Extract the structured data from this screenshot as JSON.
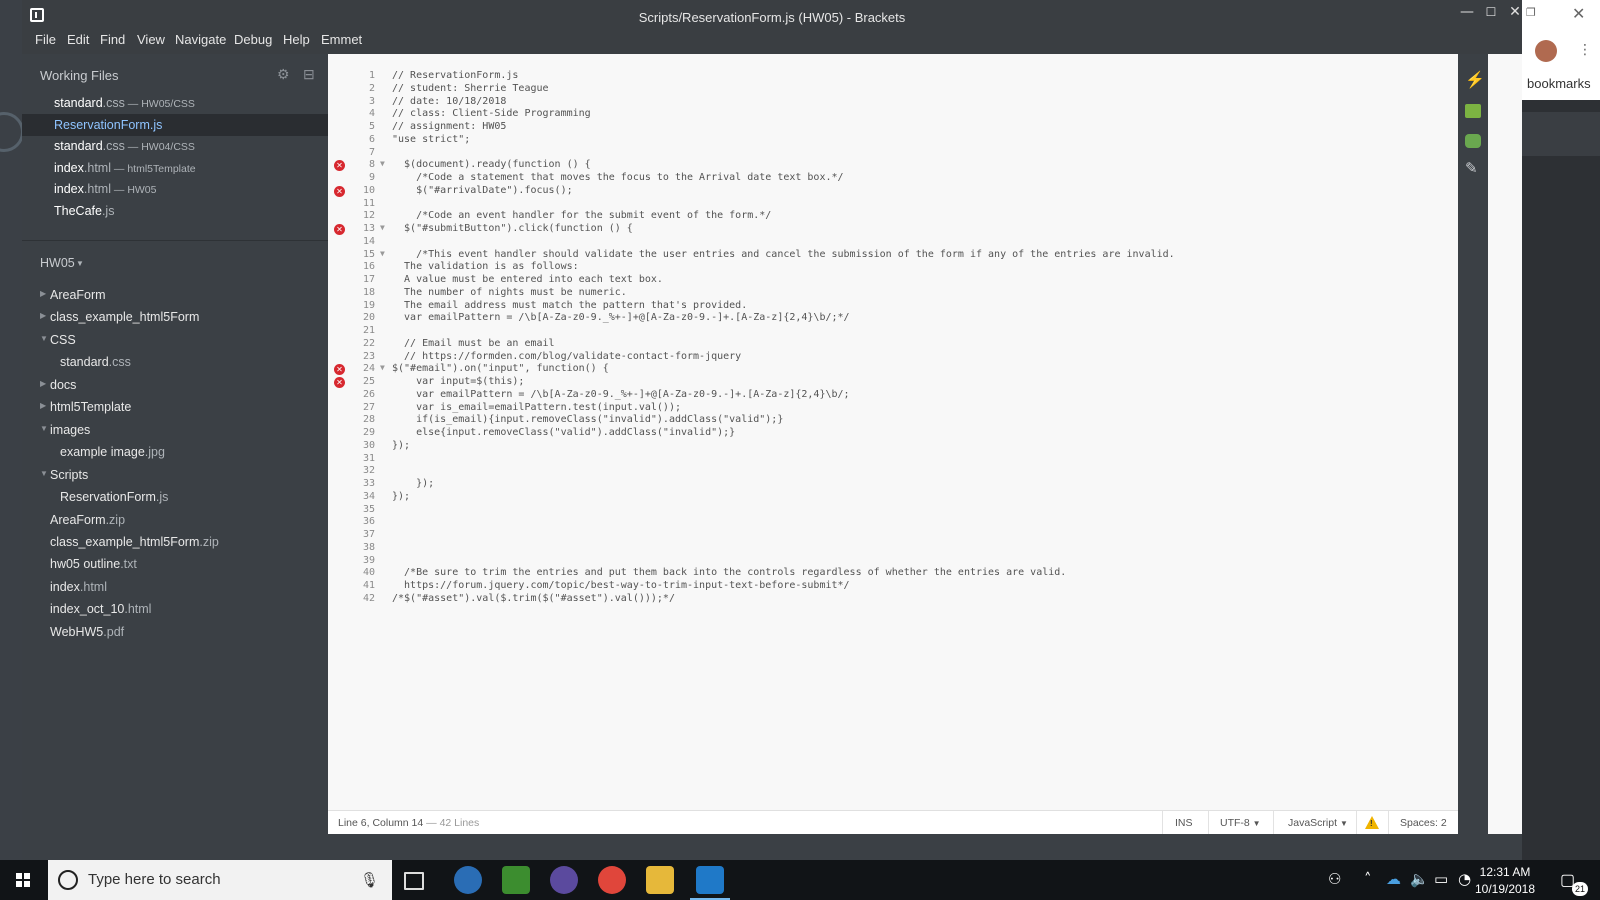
{
  "window": {
    "title": "Scripts/ReservationForm.js (HW05) - Brackets"
  },
  "menubar": [
    "File",
    "Edit",
    "Find",
    "View",
    "Navigate",
    "Debug",
    "Help",
    "Emmet"
  ],
  "sidebar": {
    "working_files_header": "Working Files",
    "working_files": [
      {
        "base": "standard",
        "ext": ".css",
        "dir": " — HW05/CSS",
        "active": false
      },
      {
        "base": "ReservationForm",
        "ext": ".js",
        "dir": "",
        "active": true
      },
      {
        "base": "standard",
        "ext": ".css",
        "dir": " — HW04/CSS",
        "active": false
      },
      {
        "base": "index",
        "ext": ".html",
        "dir": " — html5Template",
        "active": false
      },
      {
        "base": "index",
        "ext": ".html",
        "dir": " — HW05",
        "active": false
      },
      {
        "base": "TheCafe",
        "ext": ".js",
        "dir": "",
        "active": false
      }
    ],
    "project_name": "HW05",
    "tree": [
      {
        "base": "AreaForm",
        "ext": "",
        "type": "folder",
        "expanded": false,
        "indent": 0
      },
      {
        "base": "class_example_html5Form",
        "ext": "",
        "type": "folder",
        "expanded": false,
        "indent": 0
      },
      {
        "base": "CSS",
        "ext": "",
        "type": "folder",
        "expanded": true,
        "indent": 0
      },
      {
        "base": "standard",
        "ext": ".css",
        "type": "file",
        "indent": 1
      },
      {
        "base": "docs",
        "ext": "",
        "type": "folder",
        "expanded": false,
        "indent": 0
      },
      {
        "base": "html5Template",
        "ext": "",
        "type": "folder",
        "expanded": false,
        "indent": 0
      },
      {
        "base": "images",
        "ext": "",
        "type": "folder",
        "expanded": true,
        "indent": 0
      },
      {
        "base": "example image",
        "ext": ".jpg",
        "type": "file",
        "indent": 1
      },
      {
        "base": "Scripts",
        "ext": "",
        "type": "folder",
        "expanded": true,
        "indent": 0
      },
      {
        "base": "ReservationForm",
        "ext": ".js",
        "type": "file",
        "indent": 1
      },
      {
        "base": "AreaForm",
        "ext": ".zip",
        "type": "file",
        "indent": 0
      },
      {
        "base": "class_example_html5Form",
        "ext": ".zip",
        "type": "file",
        "indent": 0
      },
      {
        "base": "hw05 outline",
        "ext": ".txt",
        "type": "file",
        "indent": 0
      },
      {
        "base": "index",
        "ext": ".html",
        "type": "file",
        "indent": 0
      },
      {
        "base": "index_oct_10",
        "ext": ".html",
        "type": "file",
        "indent": 0
      },
      {
        "base": "WebHW5",
        "ext": ".pdf",
        "type": "file",
        "indent": 0
      }
    ]
  },
  "editor": {
    "lines": [
      {
        "n": "1",
        "text": "// ReservationForm.js"
      },
      {
        "n": "2",
        "text": "// student: Sherrie Teague"
      },
      {
        "n": "3",
        "text": "// date: 10/18/2018"
      },
      {
        "n": "4",
        "text": "// class: Client-Side Programming"
      },
      {
        "n": "5",
        "text": "// assignment: HW05"
      },
      {
        "n": "6",
        "text": "\"use strict\";"
      },
      {
        "n": "7",
        "text": ""
      },
      {
        "n": "8",
        "text": "  $(document).ready(function () {",
        "error": true,
        "fold": true
      },
      {
        "n": "9",
        "text": "    /*Code a statement that moves the focus to the Arrival date text box.*/"
      },
      {
        "n": "10",
        "text": "    $(\"#arrivalDate\").focus();",
        "error": true
      },
      {
        "n": "11",
        "text": ""
      },
      {
        "n": "12",
        "text": "    /*Code an event handler for the submit event of the form.*/"
      },
      {
        "n": "13",
        "text": "  $(\"#submitButton\").click(function () {",
        "error": true,
        "fold": true
      },
      {
        "n": "14",
        "text": ""
      },
      {
        "n": "15",
        "text": "    /*This event handler should validate the user entries and cancel the submission of the form if any of the entries are invalid.",
        "fold": true
      },
      {
        "n": "16",
        "text": "  The validation is as follows:"
      },
      {
        "n": "17",
        "text": "  A value must be entered into each text box."
      },
      {
        "n": "18",
        "text": "  The number of nights must be numeric."
      },
      {
        "n": "19",
        "text": "  The email address must match the pattern that's provided."
      },
      {
        "n": "20",
        "text": "  var emailPattern = /\\b[A-Za-z0-9._%+-]+@[A-Za-z0-9.-]+.[A-Za-z]{2,4}\\b/;*/"
      },
      {
        "n": "21",
        "text": ""
      },
      {
        "n": "22",
        "text": "  // Email must be an email"
      },
      {
        "n": "23",
        "text": "  // https://formden.com/blog/validate-contact-form-jquery"
      },
      {
        "n": "24",
        "text": "$(\"#email\").on(\"input\", function() {",
        "error": true,
        "fold": true
      },
      {
        "n": "25",
        "text": "    var input=$(this);",
        "error": true
      },
      {
        "n": "26",
        "text": "    var emailPattern = /\\b[A-Za-z0-9._%+-]+@[A-Za-z0-9.-]+.[A-Za-z]{2,4}\\b/;"
      },
      {
        "n": "27",
        "text": "    var is_email=emailPattern.test(input.val());"
      },
      {
        "n": "28",
        "text": "    if(is_email){input.removeClass(\"invalid\").addClass(\"valid\");}"
      },
      {
        "n": "29",
        "text": "    else{input.removeClass(\"valid\").addClass(\"invalid\");}"
      },
      {
        "n": "30",
        "text": "});"
      },
      {
        "n": "31",
        "text": ""
      },
      {
        "n": "32",
        "text": ""
      },
      {
        "n": "33",
        "text": "    });"
      },
      {
        "n": "34",
        "text": "});"
      },
      {
        "n": "35",
        "text": ""
      },
      {
        "n": "36",
        "text": ""
      },
      {
        "n": "37",
        "text": ""
      },
      {
        "n": "38",
        "text": ""
      },
      {
        "n": "39",
        "text": ""
      },
      {
        "n": "40",
        "text": "  /*Be sure to trim the entries and put them back into the controls regardless of whether the entries are valid."
      },
      {
        "n": "41",
        "text": "  https://forum.jquery.com/topic/best-way-to-trim-input-text-before-submit*/"
      },
      {
        "n": "42",
        "text": "/*$(\"#asset\").val($.trim($(\"#asset\").val()));*/"
      }
    ]
  },
  "statusbar": {
    "position": "Line 6, Column 14",
    "line_count": " — 42 Lines",
    "ins": "INS",
    "encoding": "UTF-8",
    "language": "JavaScript",
    "spaces": "Spaces: 2",
    "warning_symbol": "!"
  },
  "background": {
    "bookmarks": "bookmarks"
  },
  "taskbar": {
    "search_placeholder": "Type here to search",
    "time": "12:31 AM",
    "date": "10/19/2018",
    "notification_count": "21"
  }
}
